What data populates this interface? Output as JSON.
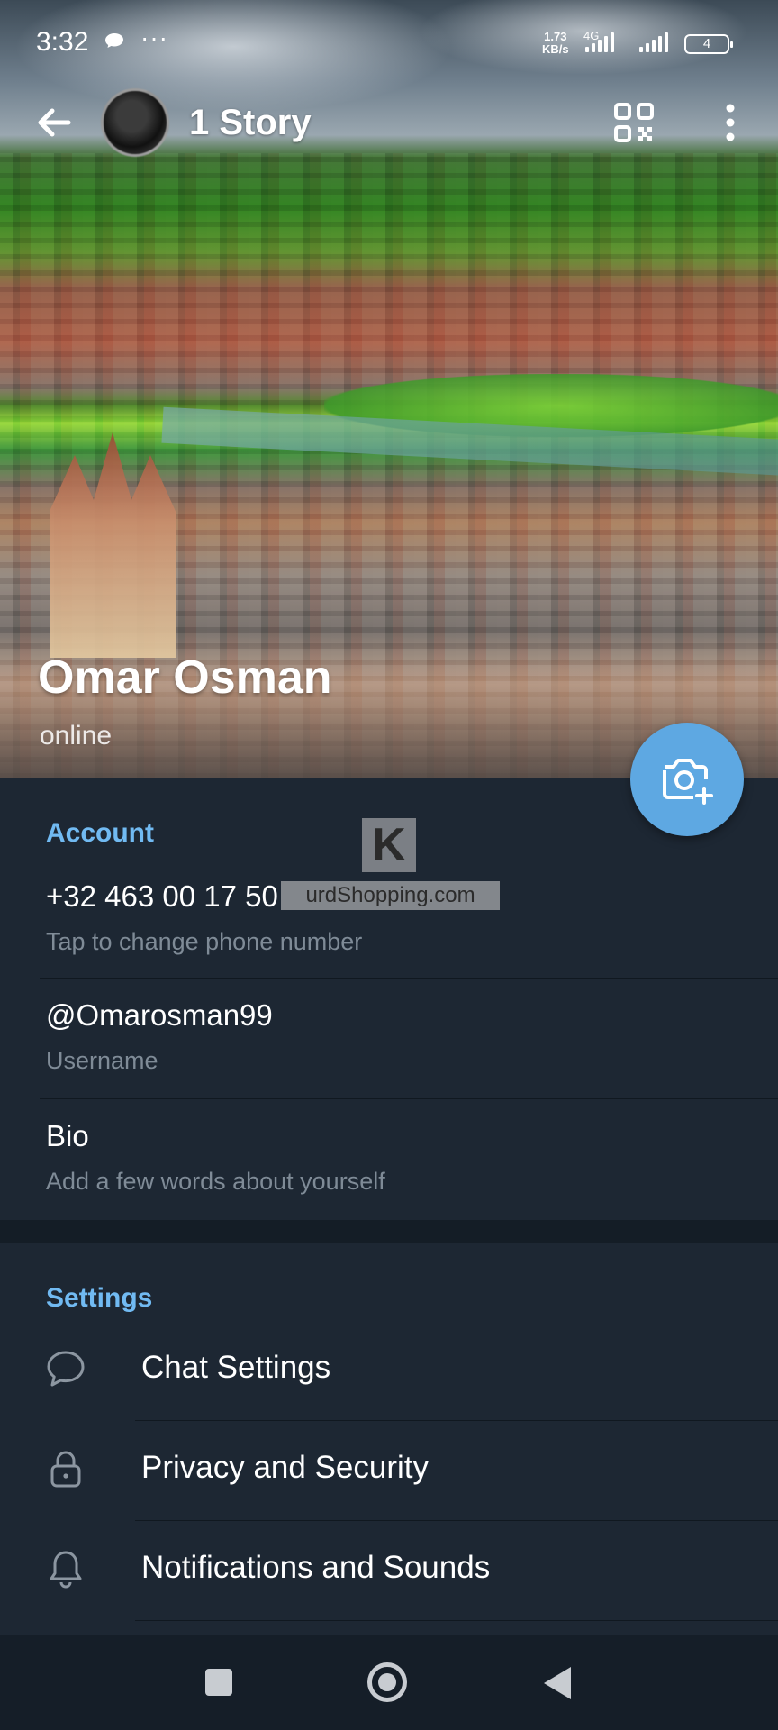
{
  "status_bar": {
    "time": "3:32",
    "net_speed_value": "1.73",
    "net_speed_unit": "KB/s",
    "network_type": "4G",
    "battery_level": "4"
  },
  "header": {
    "story_label": "1 Story",
    "name": "Omar Osman",
    "presence": "online"
  },
  "account": {
    "title": "Account",
    "phone": "+32 463 00 17 50",
    "phone_hint": "Tap to change phone number",
    "username": "@Omarosman99",
    "username_hint": "Username",
    "bio": "Bio",
    "bio_hint": "Add a few words about yourself"
  },
  "settings": {
    "title": "Settings",
    "items": [
      {
        "label": "Chat Settings",
        "icon": "chat-bubble-icon"
      },
      {
        "label": "Privacy and Security",
        "icon": "lock-icon"
      },
      {
        "label": "Notifications and Sounds",
        "icon": "bell-icon"
      }
    ]
  },
  "watermark": {
    "letter": "K",
    "text": "urdShopping.com"
  },
  "colors": {
    "background": "#1d2733",
    "accent": "#71baf2",
    "fab": "#5ea8e2",
    "secondary_text": "#7f8b97"
  }
}
